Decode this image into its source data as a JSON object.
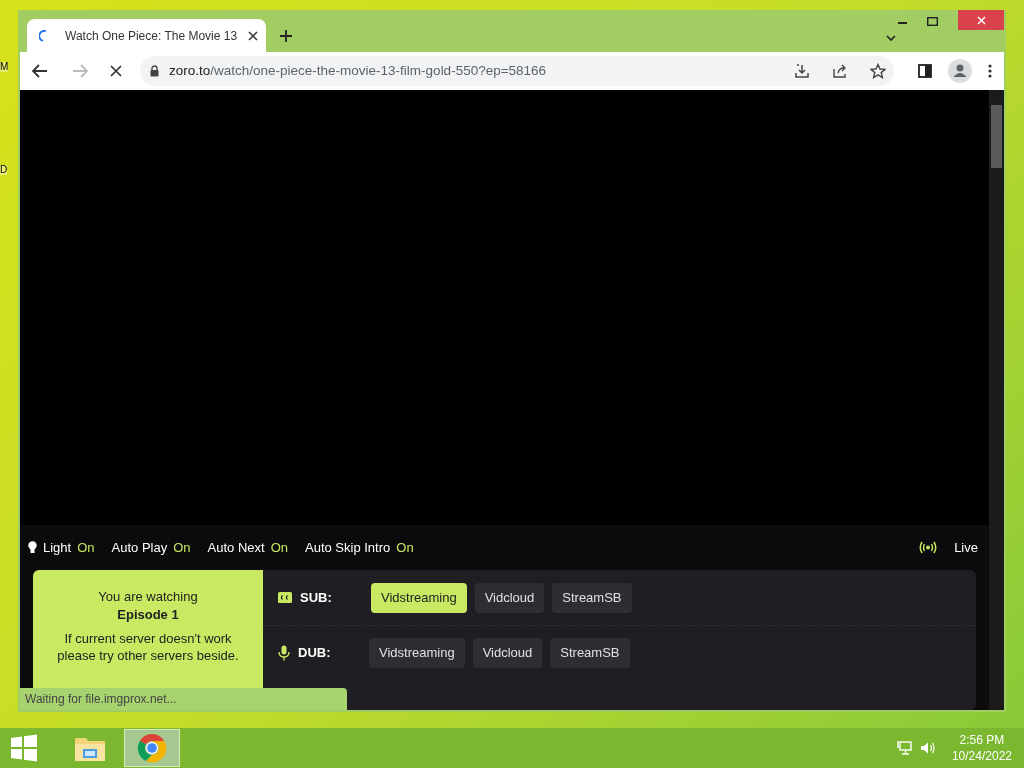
{
  "desktop_labels": [
    "M",
    "D"
  ],
  "browser": {
    "tabs": [
      {
        "title": "Watch One Piece: The Movie 13",
        "selected": true
      }
    ],
    "address": {
      "host": "zoro.to",
      "path": "/watch/one-piece-the-movie-13-film-gold-550?ep=58166"
    },
    "loading": true
  },
  "player": {
    "toggles": [
      {
        "label": "Light",
        "value": "On",
        "kind": "light"
      },
      {
        "label": "Auto Play",
        "value": "On",
        "kind": "plain"
      },
      {
        "label": "Auto Next",
        "value": "On",
        "kind": "plain"
      },
      {
        "label": "Auto Skip Intro",
        "value": "On",
        "kind": "plain"
      }
    ],
    "live": "Live"
  },
  "servers": {
    "watching": {
      "intro": "You are watching",
      "episode": "Episode 1",
      "note": "If current server doesn't work please try other servers beside."
    },
    "groups": [
      {
        "kind": "sub",
        "label": "SUB:",
        "servers": [
          {
            "name": "Vidstreaming",
            "selected": true
          },
          {
            "name": "Vidcloud",
            "selected": false
          },
          {
            "name": "StreamSB",
            "selected": false
          }
        ]
      },
      {
        "kind": "dub",
        "label": "DUB:",
        "servers": [
          {
            "name": "Vidstreaming",
            "selected": false
          },
          {
            "name": "Vidcloud",
            "selected": false
          },
          {
            "name": "StreamSB",
            "selected": false
          }
        ]
      }
    ]
  },
  "status_bar": "Waiting for file.imgprox.net...",
  "taskbar": {
    "apps": [
      {
        "kind": "explorer",
        "selected": false
      },
      {
        "kind": "chrome",
        "selected": true
      }
    ],
    "time": "2:56 PM",
    "date": "10/24/2022"
  }
}
